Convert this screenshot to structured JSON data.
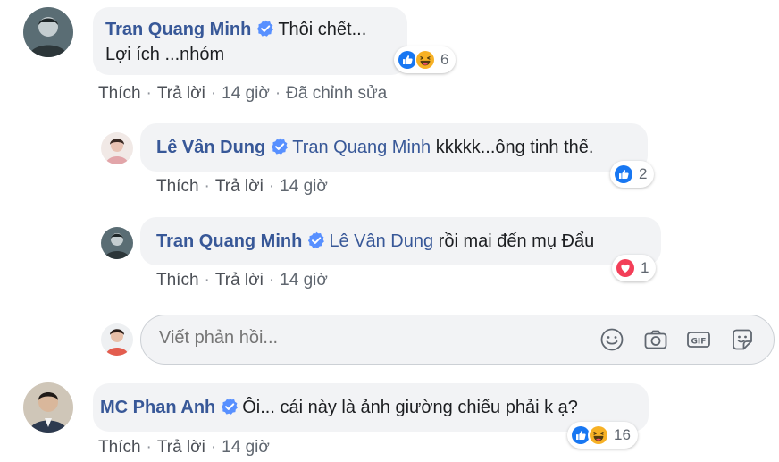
{
  "colors": {
    "link": "#385898",
    "like": "#1877f2",
    "love": "#f33e58",
    "haha": "#f7b125"
  },
  "comments": [
    {
      "author": "Tran Quang Minh",
      "text_line1": "Thôi chết...",
      "text_line2": "Lợi ích ...nhóm",
      "reactions": [
        "like-icon",
        "haha-icon"
      ],
      "reaction_count": "6",
      "actions": {
        "like": "Thích",
        "reply": "Trả lời",
        "time": "14 giờ",
        "edited": "Đã chỉnh sửa"
      }
    },
    {
      "author": "Lê Vân Dung",
      "mention": "Tran Quang Minh",
      "text": "kkkkk...ông tinh thế.",
      "reactions": [
        "like-icon"
      ],
      "reaction_count": "2",
      "actions": {
        "like": "Thích",
        "reply": "Trả lời",
        "time": "14 giờ"
      }
    },
    {
      "author": "Tran Quang Minh",
      "mention": "Lê Vân Dung",
      "text": "rồi mai đến mụ Đẩu",
      "reactions": [
        "love-icon"
      ],
      "reaction_count": "1",
      "actions": {
        "like": "Thích",
        "reply": "Trả lời",
        "time": "14 giờ"
      }
    },
    {
      "author": "MC Phan Anh",
      "text": "Ôi... cái này là ảnh giường chiếu phải k ạ?",
      "reactions": [
        "like-icon",
        "haha-icon"
      ],
      "reaction_count": "16",
      "actions": {
        "like": "Thích",
        "reply": "Trả lời",
        "time": "14 giờ"
      }
    }
  ],
  "reply_box": {
    "placeholder": "Viết phản hồi...",
    "icons": [
      "emoji-icon",
      "camera-icon",
      "gif-icon",
      "sticker-icon"
    ]
  }
}
